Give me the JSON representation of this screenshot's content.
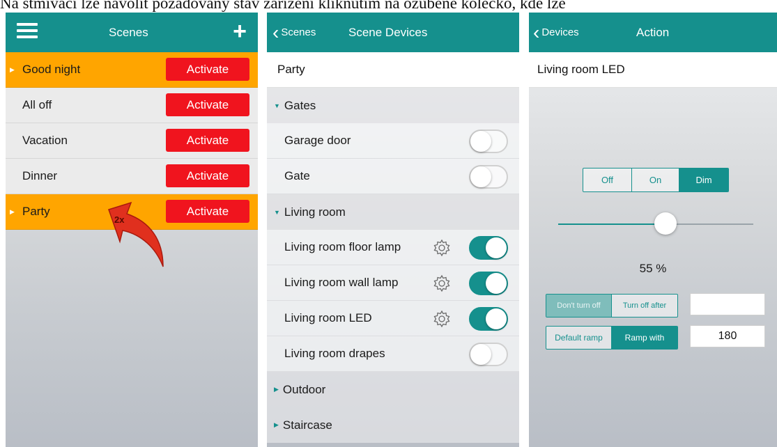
{
  "caption": "Na stmívači lze navolit požadovaný stav zařízení kliknutím na ozubené kolečko, kde lze",
  "screen1": {
    "title": "Scenes",
    "add_glyph": "+",
    "scenes": [
      {
        "name": "Good night",
        "action": "Activate",
        "highlighted": true
      },
      {
        "name": "All off",
        "action": "Activate",
        "highlighted": false
      },
      {
        "name": "Vacation",
        "action": "Activate",
        "highlighted": false
      },
      {
        "name": "Dinner",
        "action": "Activate",
        "highlighted": false
      },
      {
        "name": "Party",
        "action": "Activate",
        "highlighted": true
      }
    ],
    "arrow_label": "2x",
    "colors": {
      "bar": "#15908d",
      "highlight": "#ffa500",
      "activate": "#f0141e",
      "arrow": "#e0301e"
    }
  },
  "screen2": {
    "back_label": "Scenes",
    "title": "Scene Devices",
    "scene_name": "Party",
    "groups": [
      {
        "name": "Gates",
        "expanded": true,
        "devices": [
          {
            "name": "Garage door",
            "on": false,
            "gear": false
          },
          {
            "name": "Gate",
            "on": false,
            "gear": false
          }
        ]
      },
      {
        "name": "Living room",
        "expanded": true,
        "devices": [
          {
            "name": "Living room floor lamp",
            "on": true,
            "gear": true
          },
          {
            "name": "Living room wall lamp",
            "on": true,
            "gear": true
          },
          {
            "name": "Living room LED",
            "on": true,
            "gear": true
          },
          {
            "name": "Living room drapes",
            "on": false,
            "gear": false
          }
        ]
      },
      {
        "name": "Outdoor",
        "expanded": false,
        "devices": []
      },
      {
        "name": "Staircase",
        "expanded": false,
        "devices": []
      }
    ]
  },
  "screen3": {
    "back_label": "Devices",
    "title": "Action",
    "device_name": "Living room LED",
    "mode_options": [
      "Off",
      "On",
      "Dim"
    ],
    "mode_selected": "Dim",
    "dim_level": 0.55,
    "percent_label": "55 %",
    "turnoff_options": [
      "Don't turn off",
      "Turn off after"
    ],
    "turnoff_selected": "Don't turn off",
    "turnoff_value": "",
    "ramp_options": [
      "Default ramp",
      "Ramp with"
    ],
    "ramp_selected": "Ramp with",
    "ramp_value": "180"
  }
}
